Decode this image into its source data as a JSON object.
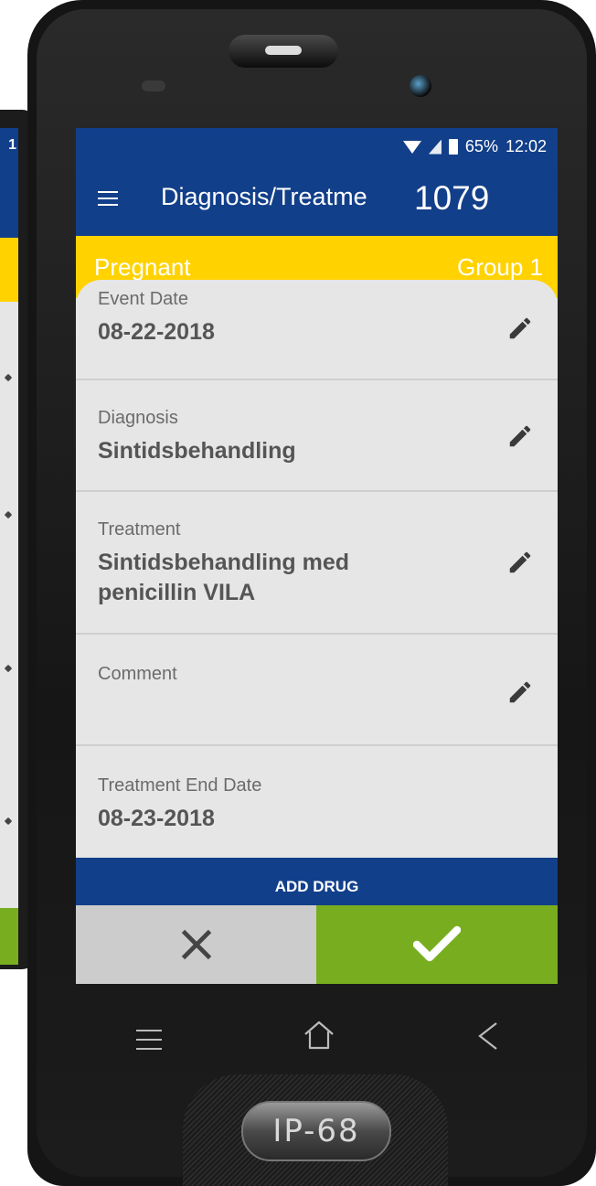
{
  "status_bar": {
    "battery": "65%",
    "time": "12:02"
  },
  "back_phone": {
    "status_fragment": "1"
  },
  "app_bar": {
    "title": "Diagnosis/Treatme",
    "number": "1079"
  },
  "subheader": {
    "left": "Pregnant",
    "right": "Group 1"
  },
  "rows": [
    {
      "label": "Event Date",
      "value": "08-22-2018",
      "editable": true
    },
    {
      "label": "Diagnosis",
      "value": "Sintidsbehandling",
      "editable": true
    },
    {
      "label": "Treatment",
      "value_line1": "Sintidsbehandling med",
      "value_line2": "penicillin VILA",
      "editable": true
    },
    {
      "label": "Comment",
      "value": "",
      "editable": true
    },
    {
      "label": "Treatment End Date",
      "value": "08-23-2018",
      "editable": false
    }
  ],
  "add_drug_label": "ADD DRUG",
  "device_badge": "IP-68",
  "colors": {
    "primary": "#123f8a",
    "accent": "#ffd200",
    "confirm": "#78ad1f",
    "cancel": "#cccccc"
  },
  "icons": {
    "menu": "hamburger-menu-icon",
    "edit": "pencil-icon",
    "cancel": "close-x-icon",
    "confirm": "checkmark-icon",
    "nav_menu": "nav-menu-icon",
    "nav_home": "home-icon",
    "nav_back": "back-chevron-icon"
  }
}
